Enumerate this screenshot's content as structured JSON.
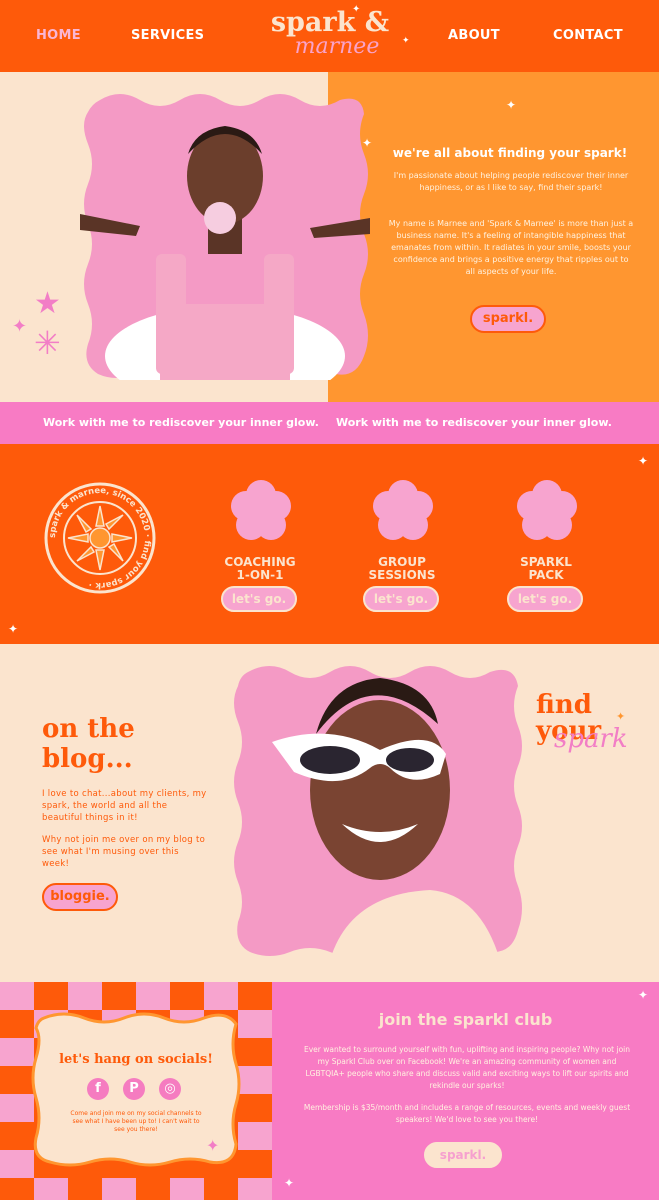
{
  "nav": {
    "items": [
      "HOME",
      "SERVICES",
      "ABOUT",
      "CONTACT"
    ],
    "logo_top": "spark &",
    "logo_bottom": "marnee"
  },
  "hero": {
    "title": "we're all about finding your spark!",
    "paragraph1": "I'm passionate about helping people rediscover their inner happiness, or as I like to say, find their spark!",
    "paragraph2": "My name is Marnee and 'Spark & Marnee' is more than just a business name. It's a feeling of intangible happiness that emanates from within. It radiates in your smile, boosts your confidence and brings a positive energy that ripples out to all aspects of your life.",
    "button": "sparkl."
  },
  "ticker": {
    "text": "Work with me to rediscover your inner glow."
  },
  "services": {
    "badge_text": "spark & marnee, since 2020 · find your spark ·",
    "items": [
      {
        "label_line1": "COACHING",
        "label_line2": "1-ON-1",
        "button": "let's go."
      },
      {
        "label_line1": "GROUP",
        "label_line2": "SESSIONS",
        "button": "let's go."
      },
      {
        "label_line1": "SPARKL",
        "label_line2": "PACK",
        "button": "let's go."
      }
    ]
  },
  "blog": {
    "heading_line1": "on the",
    "heading_line2": "blog...",
    "paragraph1": "I love to chat...about my clients, my spark, the world and all the beautiful things in it!",
    "paragraph2": "Why not join me over on my blog to see what I'm musing over this week!",
    "button": "bloggie.",
    "find_your_line1": "find",
    "find_your_line2": "your",
    "find_your_line3": "spark"
  },
  "social": {
    "heading": "let's hang on socials!",
    "icons": [
      "facebook-icon",
      "pinterest-icon",
      "instagram-icon"
    ],
    "paragraph": "Come and join me on my social channels to see what I have been up to! I can't wait to see you there!"
  },
  "club": {
    "heading": "join the sparkl club",
    "paragraph1": "Ever wanted to surround yourself with fun, uplifting and inspiring people? Why not join my Sparkl Club over on Facebook! We're an amazing community of women and LGBTQIA+ people who share and discuss valid and exciting ways to lift our spirits and rekindle our sparks!",
    "paragraph2": "Membership is $35/month and includes a range of resources, events and weekly guest speakers! We'd love to see you there!",
    "button": "sparkl."
  },
  "colors": {
    "orange": "#fe5a0a",
    "light_orange": "#ff9630",
    "cream": "#fbe4ce",
    "pink": "#f87bc4",
    "light_pink": "#f7a4cf"
  }
}
